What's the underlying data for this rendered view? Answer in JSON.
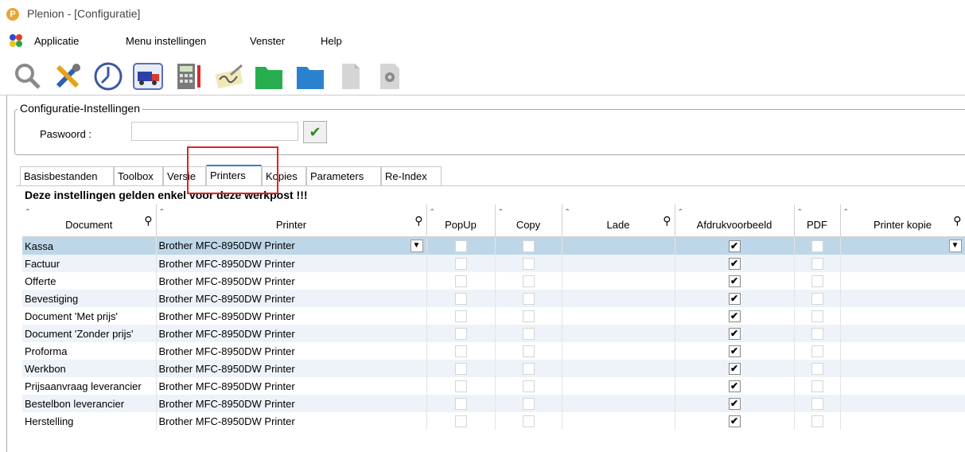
{
  "window": {
    "title": "Plenion - [Configuratie]",
    "logo_letter": "P"
  },
  "menu": [
    "Applicatie",
    "Menu instellingen",
    "Venster",
    "Help"
  ],
  "toolbar": [
    "search-icon",
    "tools-icon",
    "clock-icon",
    "delivery-truck-icon",
    "calculator-icon",
    "signature-icon",
    "green-folder-icon",
    "blue-folder-icon",
    "document-icon",
    "settings-icon"
  ],
  "config": {
    "title": "Configuratie-Instellingen",
    "password_label": "Paswoord :",
    "password_value": "",
    "confirm_symbol": "✔"
  },
  "tabs": [
    "Basisbestanden",
    "Toolbox",
    "Versie",
    "Printers",
    "Kopies",
    "Parameters",
    "Re-Index"
  ],
  "active_tab": "Printers",
  "notice": "Deze instellingen gelden enkel voor deze werkpost !!!",
  "columns": [
    "Document",
    "Printer",
    "PopUp",
    "Copy",
    "Lade",
    "Afdrukvoorbeeld",
    "PDF",
    "Printer kopie"
  ],
  "rows": [
    {
      "document": "Kassa",
      "printer": "Brother MFC-8950DW Printer",
      "popup": false,
      "copy": false,
      "lade": "",
      "preview": true,
      "pdf": false,
      "printer_kopie": ""
    },
    {
      "document": "Factuur",
      "printer": "Brother MFC-8950DW Printer",
      "popup": false,
      "copy": false,
      "lade": "",
      "preview": true,
      "pdf": false,
      "printer_kopie": ""
    },
    {
      "document": "Offerte",
      "printer": "Brother MFC-8950DW Printer",
      "popup": false,
      "copy": false,
      "lade": "",
      "preview": true,
      "pdf": false,
      "printer_kopie": ""
    },
    {
      "document": "Bevestiging",
      "printer": "Brother MFC-8950DW Printer",
      "popup": false,
      "copy": false,
      "lade": "",
      "preview": true,
      "pdf": false,
      "printer_kopie": ""
    },
    {
      "document": "Document 'Met prijs'",
      "printer": "Brother MFC-8950DW Printer",
      "popup": false,
      "copy": false,
      "lade": "",
      "preview": true,
      "pdf": false,
      "printer_kopie": ""
    },
    {
      "document": "Document 'Zonder prijs'",
      "printer": "Brother MFC-8950DW Printer",
      "popup": false,
      "copy": false,
      "lade": "",
      "preview": true,
      "pdf": false,
      "printer_kopie": ""
    },
    {
      "document": "Proforma",
      "printer": "Brother MFC-8950DW Printer",
      "popup": false,
      "copy": false,
      "lade": "",
      "preview": true,
      "pdf": false,
      "printer_kopie": ""
    },
    {
      "document": "Werkbon",
      "printer": "Brother MFC-8950DW Printer",
      "popup": false,
      "copy": false,
      "lade": "",
      "preview": true,
      "pdf": false,
      "printer_kopie": ""
    },
    {
      "document": "Prijsaanvraag leverancier",
      "printer": "Brother MFC-8950DW Printer",
      "popup": false,
      "copy": false,
      "lade": "",
      "preview": true,
      "pdf": false,
      "printer_kopie": ""
    },
    {
      "document": "Bestelbon leverancier",
      "printer": "Brother MFC-8950DW Printer",
      "popup": false,
      "copy": false,
      "lade": "",
      "preview": true,
      "pdf": false,
      "printer_kopie": ""
    },
    {
      "document": "Herstelling",
      "printer": "Brother MFC-8950DW Printer",
      "popup": false,
      "copy": false,
      "lade": "",
      "preview": true,
      "pdf": false,
      "printer_kopie": ""
    }
  ],
  "selected_row": 0,
  "colors": {
    "selection": "#bed7e8",
    "alt_row": "#edf3f8",
    "highlight": "#e32222",
    "active_tab": "#3a7bd5"
  }
}
